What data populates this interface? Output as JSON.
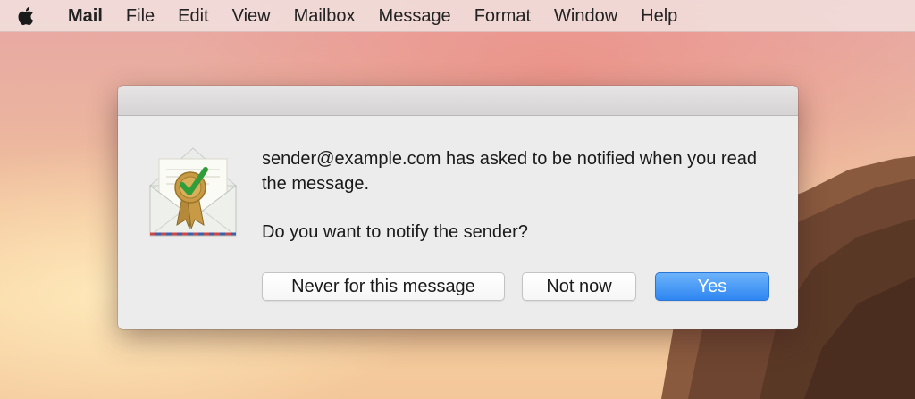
{
  "menubar": {
    "apple_icon": "apple-logo-icon",
    "app_name": "Mail",
    "items": [
      "File",
      "Edit",
      "View",
      "Mailbox",
      "Message",
      "Format",
      "Window",
      "Help"
    ]
  },
  "dialog": {
    "icon": "envelope-read-receipt-icon",
    "message": "sender@example.com has asked to be notified when you read the message.",
    "question": "Do you want to notify the sender?",
    "buttons": {
      "never": "Never for this message",
      "not_now": "Not now",
      "yes": "Yes"
    }
  },
  "colors": {
    "primary_button": "#2f86f2",
    "dialog_bg": "#ececec"
  }
}
